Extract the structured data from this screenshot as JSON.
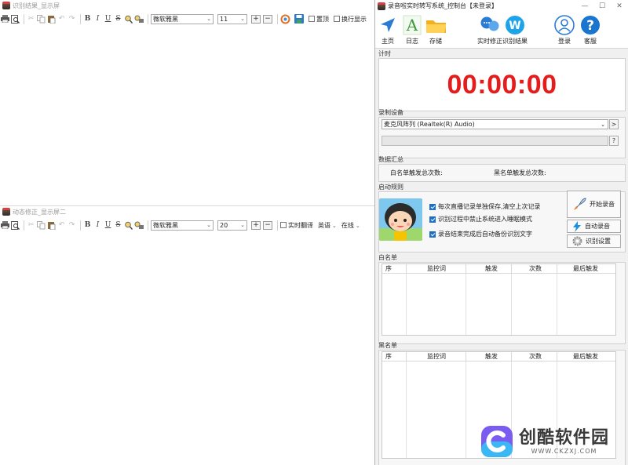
{
  "left_top": {
    "title": "识别结果_显示屏",
    "font_name": "微软雅黑",
    "font_size": "11",
    "checks": [
      "置顶",
      "换行显示"
    ]
  },
  "left_bottom": {
    "title": "动态修正_显示屏二",
    "font_name": "微软雅黑",
    "font_size": "20",
    "check_translate": "实时翻译",
    "lang": "英语",
    "mode": "在线"
  },
  "toolbar_glyphs": {
    "bold": "B",
    "italic": "I",
    "underline": "U",
    "strike": "S",
    "plus": "+",
    "minus": "−"
  },
  "console": {
    "title": "录音啦实时转写系统_控制台【未登录】",
    "toolbar": {
      "home": "主页",
      "log": "日志",
      "save": "存储",
      "correct": "实时修正",
      "result": "识别结果",
      "login": "登录",
      "service": "客服"
    },
    "timer_label": "计时",
    "timer_value": "00:00:00",
    "device_label": "录制设备",
    "device_value": "麦克风阵列 (Realtek(R) Audio)",
    "device_more": ">",
    "help_btn": "?",
    "stats_label": "数据汇总",
    "white_count_label": "白名单触发总次数:",
    "black_count_label": "黑名单触发总次数:",
    "startup_label": "启动规则",
    "options": [
      "每次直播记录单独保存,清空上次记录",
      "识别过程中禁止系统进入睡眠模式",
      "录音结束完成后自动备份识别文字"
    ],
    "buttons": {
      "start": "开始录音",
      "auto": "自动录音",
      "settings": "识别设置"
    },
    "whitelist_label": "白名单",
    "blacklist_label": "黑名单",
    "columns": [
      "序",
      "监控词",
      "触发",
      "次数",
      "最后触发"
    ]
  },
  "watermark": {
    "name": "创酷软件园",
    "url": "WWW.CKZXJ.COM"
  },
  "colors": {
    "timer": "#e51c1c",
    "accent": "#1b6fc5"
  }
}
